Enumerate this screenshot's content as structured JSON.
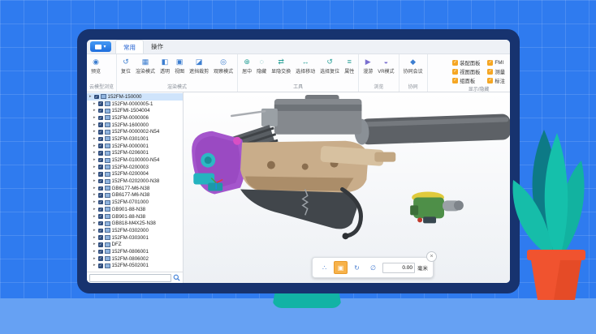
{
  "app": {
    "logo_caret": "▾",
    "tabs": [
      {
        "label": "常用"
      },
      {
        "label": "操作"
      }
    ]
  },
  "ribbon": {
    "check_glyph": "✓",
    "groups": [
      {
        "label": "云模型浏览",
        "buttons": [
          {
            "label": "预览",
            "glyph": "◉"
          }
        ]
      },
      {
        "label": "渲染模式",
        "buttons": [
          {
            "label": "复位",
            "glyph": "↺"
          },
          {
            "label": "渲染模式",
            "glyph": "▦"
          },
          {
            "label": "透明",
            "glyph": "◧"
          },
          {
            "label": "视图",
            "glyph": "▣"
          },
          {
            "label": "遮挡裁剪",
            "glyph": "◪"
          },
          {
            "label": "观察模式",
            "glyph": "◎"
          }
        ]
      },
      {
        "label": "工具",
        "buttons": [
          {
            "label": "居中",
            "glyph": "⊕"
          },
          {
            "label": "隐藏",
            "glyph": "◌"
          },
          {
            "label": "显隐交换",
            "glyph": "⇄"
          },
          {
            "label": "选择移动",
            "glyph": "↔"
          },
          {
            "label": "选择复位",
            "glyph": "↺"
          },
          {
            "label": "属性",
            "glyph": "≡"
          }
        ]
      },
      {
        "label": "浏览",
        "buttons": [
          {
            "label": "漫游",
            "glyph": "▶"
          },
          {
            "label": "VR模式",
            "glyph": "◒"
          }
        ]
      },
      {
        "label": "协同",
        "buttons": [
          {
            "label": "协同会议",
            "glyph": "◆"
          }
        ]
      }
    ],
    "display_group": {
      "label": "显示/隐藏",
      "items": [
        {
          "label": "装配面板"
        },
        {
          "label": "视图面板"
        },
        {
          "label": "组面板"
        },
        {
          "label": "FMI"
        },
        {
          "label": "测量"
        },
        {
          "label": "标注"
        }
      ]
    }
  },
  "tree": {
    "arrow_glyph": "▸",
    "check_glyph": "✓",
    "search_value": "",
    "items": [
      "152FM-150000",
      "152FM-0000005-1",
      "152FMI-1504004",
      "152FM-0000006",
      "152FM-1600000",
      "152FM-0000002-N54",
      "152FM-0301001",
      "152FM-0000001",
      "152FM-0206001",
      "152FM-0100000-N54",
      "152FM-0200003",
      "152FM-0200004",
      "152FM-0202000-N38",
      "GB6177-M6-N38",
      "GB6177-M6-N38",
      "152FM-0701000",
      "GB901-88-N38",
      "GB901-88-N38",
      "GB818-M4X25-N38",
      "152FM-0302000",
      "152FM-0303001",
      "DFZ",
      "152FM-0806001",
      "152FM-0806002",
      "152FM-0502001"
    ]
  },
  "bottom_toolbar": {
    "buttons": [
      {
        "name": "pan",
        "glyph": "∴"
      },
      {
        "name": "fit",
        "glyph": "▣"
      },
      {
        "name": "rotate",
        "glyph": "↻"
      },
      {
        "name": "measure",
        "glyph": "∅"
      }
    ],
    "value": "0.00",
    "unit": "毫米",
    "close_glyph": "×"
  },
  "colors": {
    "background_blue": "#2f7bef",
    "laptop_navy": "#17336f",
    "stand_teal": "#12b3a5",
    "pot_orange": "#f0532f",
    "accent_orange": "#f5a623",
    "tree_check_navy": "#2f4d7d",
    "selection_blue": "#cfe4fb"
  }
}
